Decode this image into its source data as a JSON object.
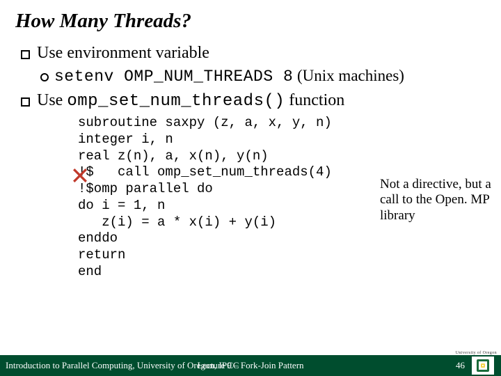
{
  "title": "How Many Threads?",
  "bullets": {
    "b1": "Use environment variable",
    "b1a_code": "setenv OMP_NUM_THREADS 8",
    "b1a_tail": " (Unix machines)",
    "b2_pre": "Use ",
    "b2_code": "omp_set_num_threads()",
    "b2_post": " function"
  },
  "code": "subroutine saxpy (z, a, x, y, n)\ninteger i, n\nreal z(n), a, x(n), y(n)\n!$   call omp_set_num_threads(4)\n!$omp parallel do\ndo i = 1, n\n   z(i) = a * x(i) + y(i)\nenddo\nreturn\nend",
  "sidenote": "Not a directive, but a call to the Open. MP library",
  "footer": {
    "left": "Introduction to Parallel Computing, University of Oregon, IPCC",
    "center": "Lecture 9 – Fork-Join Pattern",
    "page": "46"
  },
  "logo_alt": "University of Oregon"
}
